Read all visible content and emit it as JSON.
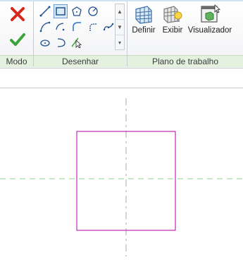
{
  "panels": {
    "mode": {
      "label": "Modo"
    },
    "draw": {
      "label": "Desenhar"
    },
    "workplane": {
      "label": "Plano de trabalho"
    }
  },
  "buttons": {
    "cancel": {
      "icon": "red-x-icon"
    },
    "finish": {
      "icon": "green-check-icon"
    },
    "definir": {
      "label": "Definir",
      "icon": "grid-plane-icon"
    },
    "exibir": {
      "label": "Exibir",
      "icon": "grid-lightbulb-icon"
    },
    "visualizador": {
      "label": "Visualizador",
      "icon": "viewer-window-icon"
    }
  },
  "draw_tools": [
    "line-tool-icon",
    "rectangle-tool-icon",
    "polygon-tool-icon",
    "circle-tool-icon",
    "start-end-arc-icon",
    "center-end-arc-icon",
    "tangent-arc-icon",
    "fillet-arc-icon",
    "spline-icon",
    "ellipse-icon",
    "partial-ellipse-icon",
    "pick-lines-icon"
  ],
  "colors": {
    "sketch": "#b000b0",
    "reference_plane": "#7fc77f",
    "center_reference": "#9aa09a",
    "panel_label_bg": "#e4f1df"
  }
}
